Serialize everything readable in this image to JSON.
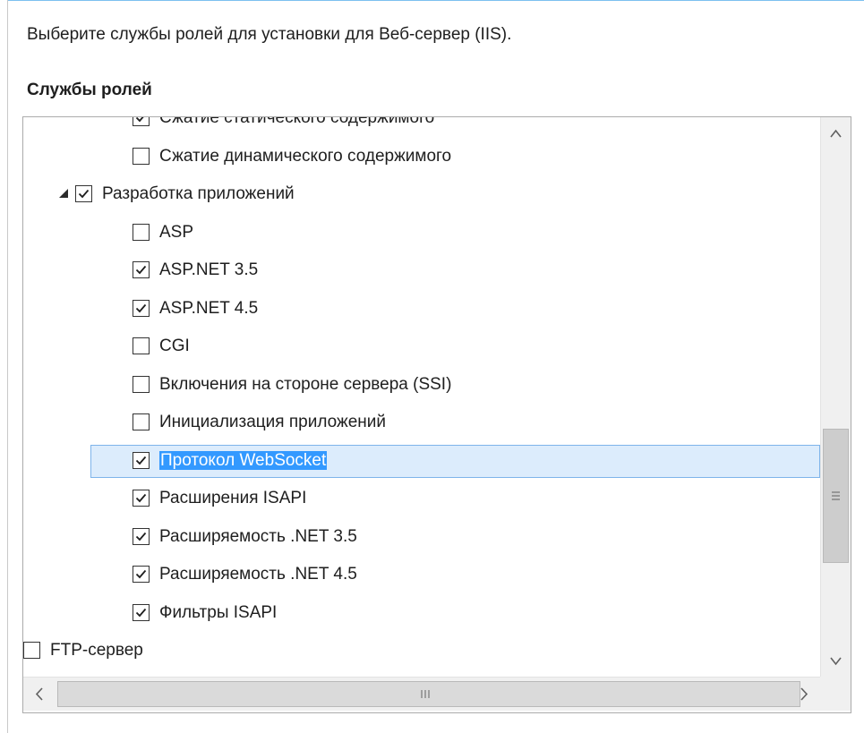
{
  "instruction": "Выберите службы ролей для установки для Веб-сервер (IIS).",
  "section_title": "Службы ролей",
  "tree_items": [
    {
      "label": "Сжатие статического содержимого",
      "checked": true,
      "level": 2,
      "clipped": true
    },
    {
      "label": "Сжатие динамического содержимого",
      "checked": false,
      "level": 2
    },
    {
      "label": "Разработка приложений",
      "checked": true,
      "level": 1,
      "expanded": true
    },
    {
      "label": "ASP",
      "checked": false,
      "level": 2
    },
    {
      "label": "ASP.NET 3.5",
      "checked": true,
      "level": 2
    },
    {
      "label": "ASP.NET 4.5",
      "checked": true,
      "level": 2
    },
    {
      "label": "CGI",
      "checked": false,
      "level": 2
    },
    {
      "label": "Включения на стороне сервера (SSI)",
      "checked": false,
      "level": 2
    },
    {
      "label": "Инициализация приложений",
      "checked": false,
      "level": 2
    },
    {
      "label": "Протокол WebSocket",
      "checked": true,
      "level": 2,
      "selected": true
    },
    {
      "label": "Расширения ISAPI",
      "checked": true,
      "level": 2
    },
    {
      "label": "Расширяемость .NET 3.5",
      "checked": true,
      "level": 2
    },
    {
      "label": "Расширяемость .NET 4.5",
      "checked": true,
      "level": 2
    },
    {
      "label": "Фильтры ISAPI",
      "checked": true,
      "level": 2
    },
    {
      "label": "FTP-сервер",
      "checked": false,
      "level": 0,
      "expanded": true
    }
  ],
  "colors": {
    "selection_fill": "#dcecfc",
    "selection_border": "#7eb4ea",
    "text_highlight": "#3399ff"
  },
  "icons": {
    "expanded": "triangle-expanded-icon",
    "check": "checkmark-icon",
    "scroll_up": "chevron-up-icon",
    "scroll_down": "chevron-down-icon",
    "scroll_left": "chevron-left-icon",
    "scroll_right": "chevron-right-icon",
    "grip": "scroll-grip-icon"
  }
}
